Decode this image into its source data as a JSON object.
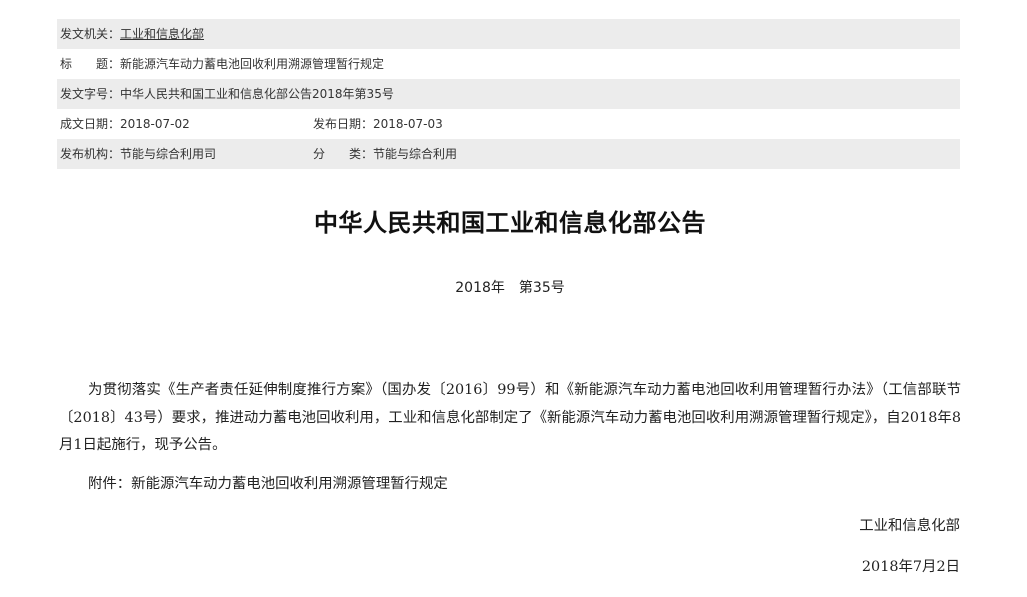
{
  "meta": {
    "issuer": {
      "label": "发文机关：",
      "value": "工业和信息化部"
    },
    "title": {
      "label": "标　　题：",
      "value": "新能源汽车动力蓄电池回收利用溯源管理暂行规定"
    },
    "doc_no": {
      "label": "发文字号：",
      "value": "中华人民共和国工业和信息化部公告2018年第35号"
    },
    "created": {
      "label": "成文日期：",
      "value": "2018-07-02"
    },
    "published": {
      "label": "发布日期：",
      "value": "2018-07-03"
    },
    "org": {
      "label": "发布机构：",
      "value": "节能与综合利用司"
    },
    "category": {
      "label": "分　　类：",
      "value": "节能与综合利用"
    }
  },
  "document": {
    "title": "中华人民共和国工业和信息化部公告",
    "number_year": "2018年",
    "number_seq": "第35号",
    "body": "为贯彻落实《生产者责任延伸制度推行方案》（国办发〔2016〕99号）和《新能源汽车动力蓄电池回收利用管理暂行办法》（工信部联节〔2018〕43号）要求，推进动力蓄电池回收利用，工业和信息化部制定了《新能源汽车动力蓄电池回收利用溯源管理暂行规定》，自2018年8月1日起施行，现予公告。",
    "attachment": "附件：新能源汽车动力蓄电池回收利用溯源管理暂行规定",
    "signature": "工业和信息化部",
    "date": "2018年7月2日"
  }
}
